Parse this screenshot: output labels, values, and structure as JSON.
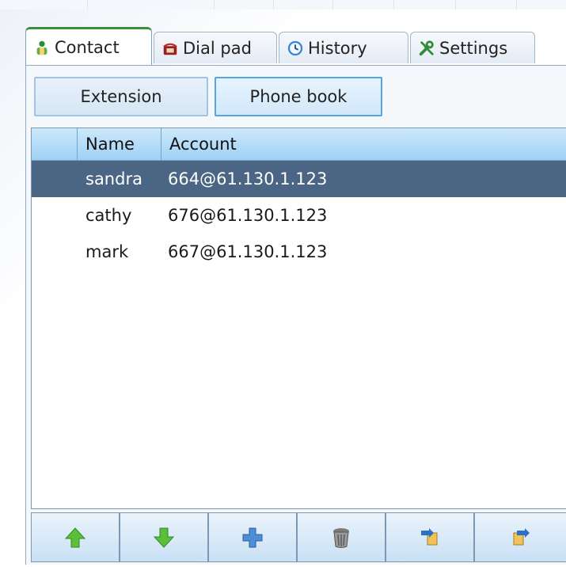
{
  "tabs": [
    {
      "label": "Contact",
      "icon": "contact-person-icon",
      "active": true
    },
    {
      "label": "Dial pad",
      "icon": "telephone-icon",
      "active": false
    },
    {
      "label": "History",
      "icon": "clock-icon",
      "active": false
    },
    {
      "label": "Settings",
      "icon": "tools-icon",
      "active": false
    }
  ],
  "subtabs": {
    "extension": "Extension",
    "phonebook": "Phone book",
    "selected": "Phone book"
  },
  "table": {
    "columns": [
      "",
      "Name",
      "Account"
    ],
    "rows": [
      {
        "name": "sandra",
        "account": "664@61.130.1.123",
        "selected": true
      },
      {
        "name": "cathy",
        "account": "676@61.130.1.123",
        "selected": false
      },
      {
        "name": "mark",
        "account": "667@61.130.1.123",
        "selected": false
      }
    ]
  },
  "toolbar": {
    "buttons": [
      "move-up-icon",
      "move-down-icon",
      "add-icon",
      "delete-trash-icon",
      "import-icon",
      "export-icon"
    ]
  },
  "colors": {
    "header_gradient_top": "#cde9fb",
    "header_gradient_bottom": "#9fd1f4",
    "selected_row": "#4a6684",
    "active_tab_accent": "#3c8f3c"
  }
}
